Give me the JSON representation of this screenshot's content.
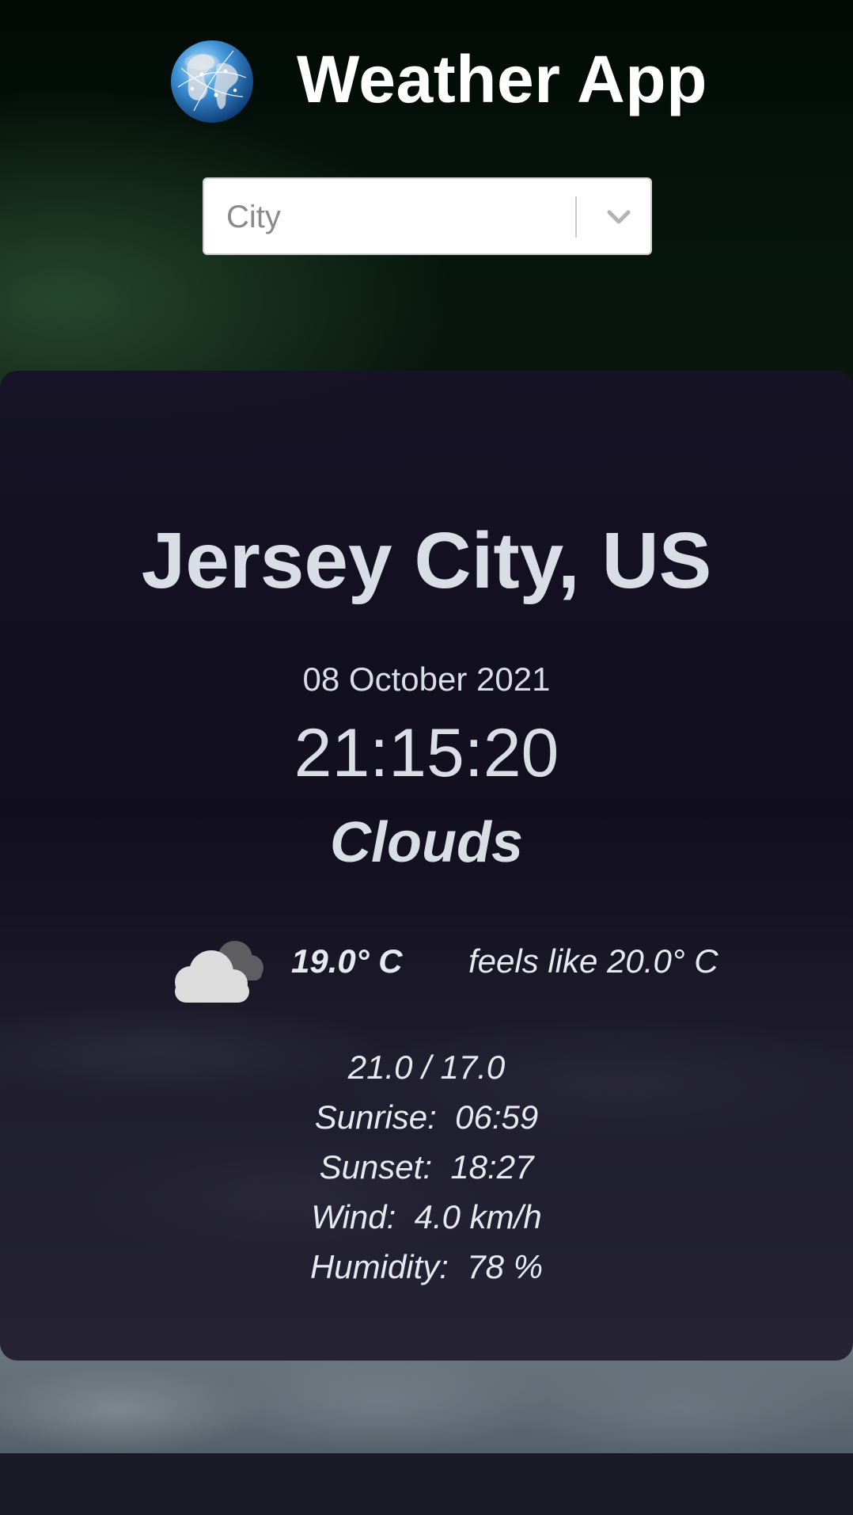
{
  "header": {
    "title": "Weather App",
    "logo_icon": "globe-icon"
  },
  "search": {
    "placeholder": "City",
    "dropdown_icon": "chevron-down-icon"
  },
  "weather": {
    "location": "Jersey City, US",
    "date": "08 October 2021",
    "time": "21:15:20",
    "condition": "Clouds",
    "condition_icon": "clouds-icon",
    "temperature": "19.0° C",
    "feels_like": "feels like 20.0° C",
    "min_max": "21.0 / 17.0",
    "sunrise": "Sunrise:  06:59",
    "sunset": "Sunset:  18:27",
    "wind": "Wind:  4.0 km/h",
    "humidity": "Humidity:  78 %"
  },
  "colors": {
    "text_primary": "#d8dde6",
    "card_background": "#15122a",
    "select_background": "#ffffff"
  }
}
